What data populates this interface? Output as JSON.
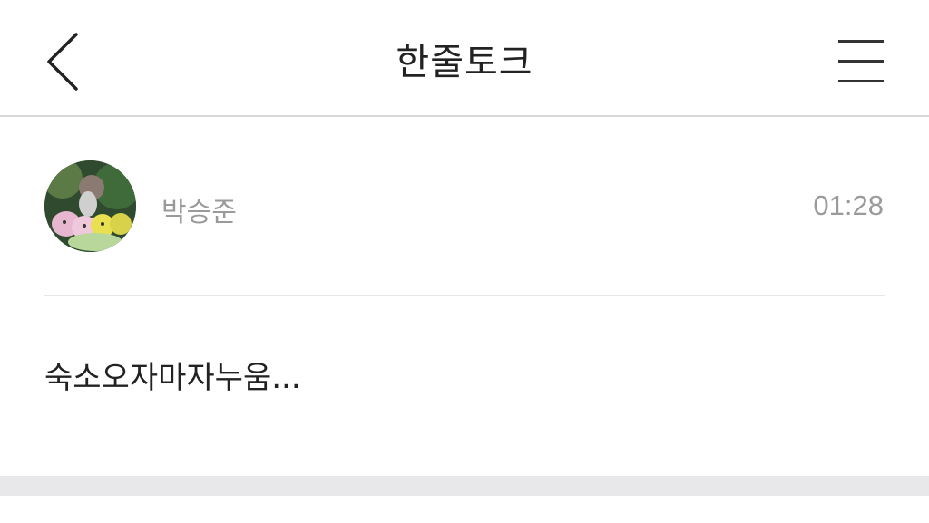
{
  "header": {
    "back_icon": "chevron-left-icon",
    "title": "한줄토크",
    "menu_icon": "hamburger-menu-icon"
  },
  "post": {
    "author": "박승준",
    "time": "01:28",
    "message": "숙소오자마자누움..."
  },
  "colors": {
    "background": "#ffffff",
    "divider": "#e6e6e6",
    "header_border": "#d9d9d9",
    "muted_text": "#9a9a9a",
    "footer_bar": "#e8e8ea"
  }
}
